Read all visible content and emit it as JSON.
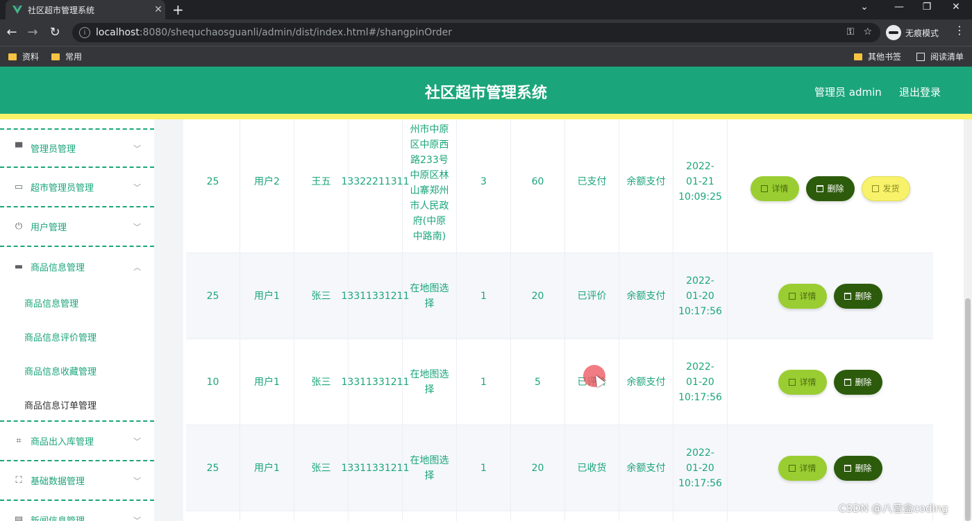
{
  "browser": {
    "tab_title": "社区超市管理系统",
    "url_host": "localhost",
    "url_rest": ":8080/shequchaosguanli/admin/dist/index.html#/shangpinOrder",
    "incognito_label": "无痕模式",
    "bookmarks": [
      "资料",
      "常用"
    ],
    "other_bookmarks": "其他书签",
    "reading_list": "阅读清单"
  },
  "header": {
    "title": "社区超市管理系统",
    "user": "管理员 admin",
    "logout": "退出登录"
  },
  "sidebar": {
    "menus": [
      {
        "label": "管理员管理",
        "icon": "monitor-icon",
        "expanded": false
      },
      {
        "label": "超市管理员管理",
        "icon": "id-card-icon",
        "expanded": false
      },
      {
        "label": "用户管理",
        "icon": "power-icon",
        "expanded": false
      },
      {
        "label": "商品信息管理",
        "icon": "shop-icon",
        "expanded": true
      },
      {
        "label": "商品出入库管理",
        "icon": "crop-icon",
        "expanded": false
      },
      {
        "label": "基础数据管理",
        "icon": "fullscreen-icon",
        "expanded": false
      },
      {
        "label": "新闻信息管理",
        "icon": "news-icon",
        "expanded": false
      }
    ],
    "submenus": [
      "商品信息管理",
      "商品信息评价管理",
      "商品信息收藏管理",
      "商品信息订单管理"
    ],
    "active_submenu": "商品信息订单管理"
  },
  "table": {
    "rows": [
      {
        "c1": "25",
        "c2": "用户2",
        "c3": "王五",
        "phone": "13322211311",
        "address": "州市中原区中原西路233号中原区林山寨郑州市人民政府(中原中路南)",
        "qty": "3",
        "price": "60",
        "status": "已支付",
        "pay": "余额支付",
        "time": "2022-01-21 10:09:25",
        "ship": true
      },
      {
        "c1": "25",
        "c2": "用户1",
        "c3": "张三",
        "phone": "13311331211",
        "address": "在地图选择",
        "qty": "1",
        "price": "20",
        "status": "已评价",
        "pay": "余额支付",
        "time": "2022-01-20 10:17:56",
        "ship": false
      },
      {
        "c1": "10",
        "c2": "用户1",
        "c3": "张三",
        "phone": "13311331211",
        "address": "在地图选择",
        "qty": "1",
        "price": "5",
        "status": "已评价",
        "pay": "余额支付",
        "time": "2022-01-20 10:17:56",
        "ship": false
      },
      {
        "c1": "25",
        "c2": "用户1",
        "c3": "张三",
        "phone": "13311331211",
        "address": "在地图选择",
        "qty": "1",
        "price": "20",
        "status": "已收货",
        "pay": "余额支付",
        "time": "2022-01-20 10:17:56",
        "ship": false
      }
    ],
    "buttons": {
      "detail": "详情",
      "delete": "删除",
      "ship": "发货"
    }
  },
  "watermark": "CSDN @八音盒coding",
  "colors": {
    "primary": "#1ba57a",
    "accent_yellow": "#f7f26a",
    "detail_btn": "#9acd32",
    "delete_btn": "#2d5b0c"
  }
}
